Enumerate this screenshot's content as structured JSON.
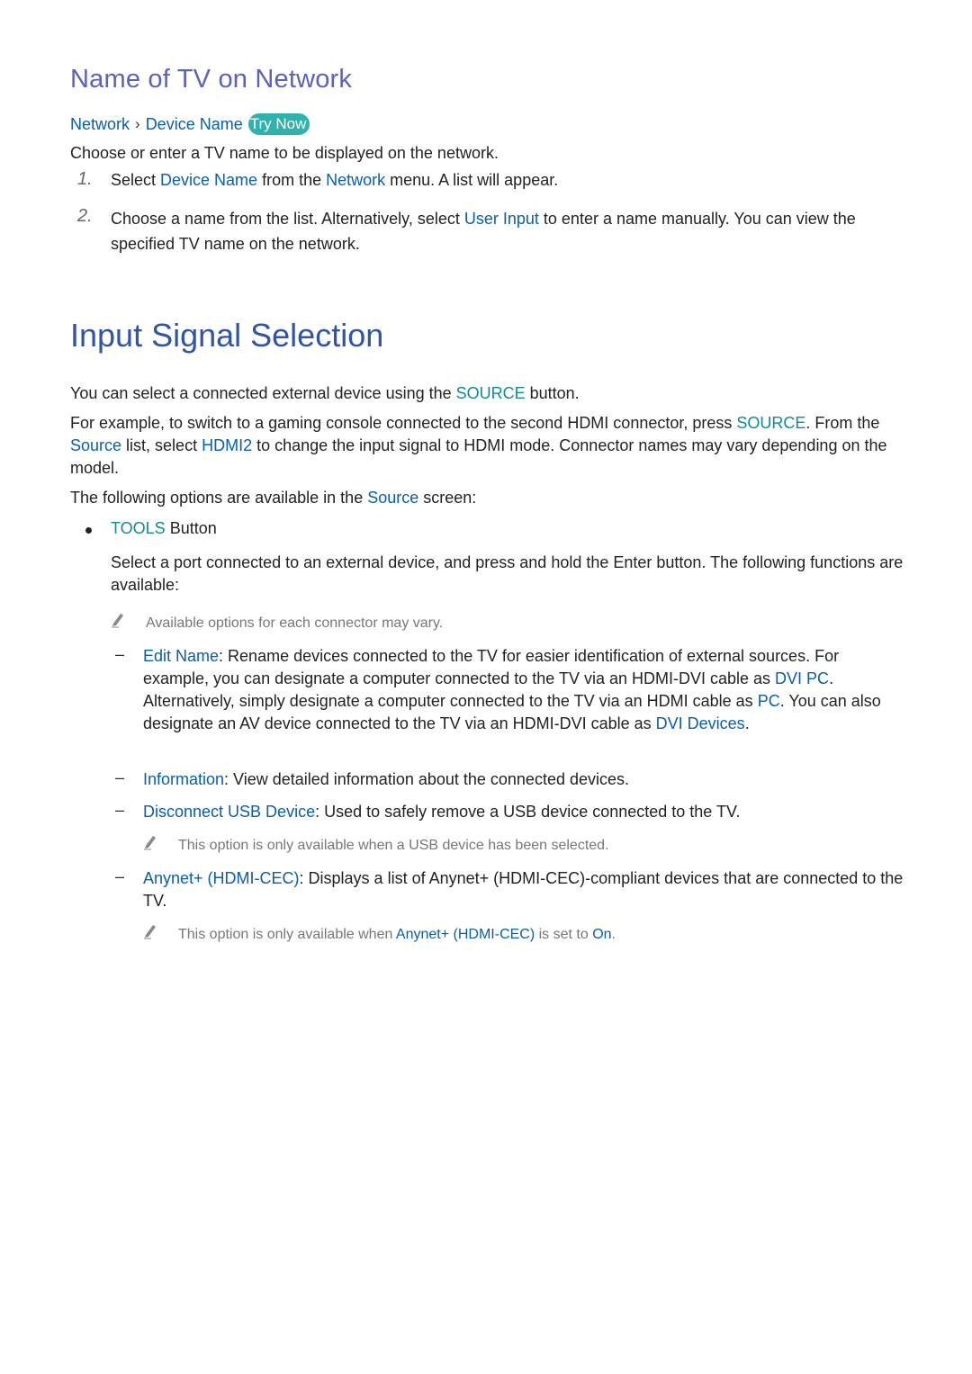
{
  "section1": {
    "title": "Name of TV on Network",
    "breadcrumb": {
      "items": [
        "Network",
        "Device Name"
      ],
      "separator": ">",
      "try_now_label": "Try Now"
    },
    "intro": "Choose or enter a TV name to be displayed on the network.",
    "steps": [
      {
        "number": "1.",
        "parts": [
          "Select ",
          "Device Name",
          " from the ",
          "Network",
          " menu. A list will appear."
        ]
      },
      {
        "number": "2.",
        "parts": [
          "Choose a name from the list. Alternatively, select ",
          "User Input",
          " to enter a name manually. You can view the specified TV name on the network."
        ]
      }
    ]
  },
  "section2": {
    "title": "Input Signal Selection",
    "para1": [
      "You can select a connected external device using the ",
      "SOURCE",
      " button."
    ],
    "para2": [
      "For example, to switch to a gaming console connected to the second HDMI connector, press ",
      "SOURCE",
      ". From the ",
      "Source",
      " list, select ",
      "HDMI2",
      " to change the input signal to HDMI mode. Connector names may vary depending on the model."
    ],
    "para3": [
      "The following options are available in the ",
      "Source",
      " screen:"
    ],
    "bullet": {
      "parts": [
        "TOOLS",
        " Button"
      ],
      "description": "Select a port connected to an external device, and press and hold the Enter button. The following functions are available:",
      "note": "Available options for each connector may vary."
    },
    "options": [
      {
        "parts": [
          "Edit Name",
          ": Rename devices connected to the TV for easier identification of external sources. For example, you can designate a computer connected to the TV via an HDMI-DVI cable as ",
          "DVI PC",
          ". Alternatively, simply designate a computer connected to the TV via an HDMI cable as ",
          "PC",
          ". You can also designate an AV device connected to the TV via an HDMI-DVI cable as ",
          "DVI Devices",
          "."
        ]
      },
      {
        "parts": [
          "Information",
          ": View detailed information about the connected devices."
        ]
      },
      {
        "parts": [
          "Disconnect USB Device",
          ": Used to safely remove a USB device connected to the TV."
        ],
        "note": "This option is only available when a USB device has been selected."
      },
      {
        "parts": [
          "Anynet+ (HDMI-CEC)",
          ": Displays a list of Anynet+ (HDMI-CEC)-compliant devices that are connected to the TV."
        ],
        "note_parts": [
          "This option is only available when ",
          "Anynet+ (HDMI-CEC)",
          " is set to ",
          "On",
          "."
        ]
      }
    ]
  },
  "colors": {
    "heading_small": "#5b62b8",
    "heading_large": "#2f55a4",
    "link_blue": "#0b5ea8",
    "button_teal": "#12899a",
    "try_now_bg": "#2fb2ad",
    "note_gray": "#777777"
  }
}
